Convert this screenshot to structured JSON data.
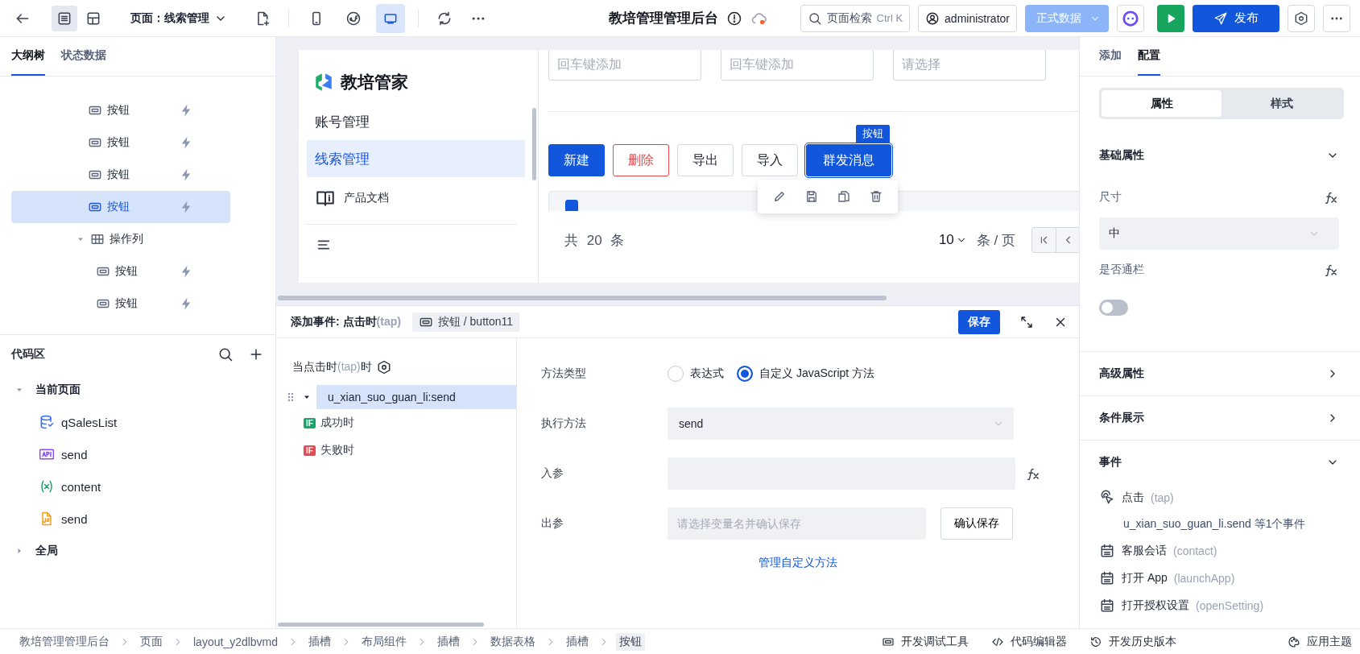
{
  "topbar": {
    "view_toggles": [
      {
        "kind": "document",
        "selected": true
      },
      {
        "kind": "layout",
        "selected": false
      }
    ],
    "page_selector": "页面：线索管理",
    "devices": [
      {
        "kind": "phone",
        "selected": false
      },
      {
        "kind": "miniapp",
        "selected": false
      },
      {
        "kind": "desktop",
        "selected": true
      }
    ],
    "app_title": "教培管理管理后台",
    "search": {
      "placeholder": "页面检索",
      "shortcut": "Ctrl K"
    },
    "user": "administrator",
    "data_mode": "正式数据",
    "publish": "发布"
  },
  "left_panel": {
    "tabs": [
      {
        "label": "大纲树",
        "selected": true
      },
      {
        "label": "状态数据",
        "selected": false
      }
    ],
    "outline": [
      {
        "kind": "button",
        "label": "按钮",
        "selected": false
      },
      {
        "kind": "button",
        "label": "按钮",
        "selected": false
      },
      {
        "kind": "button",
        "label": "按钮",
        "selected": false
      },
      {
        "kind": "button",
        "label": "按钮",
        "selected": true
      },
      {
        "kind": "table",
        "label": "操作列",
        "selected": false,
        "expanded": true,
        "children": [
          {
            "kind": "button",
            "label": "按钮",
            "selected": false
          },
          {
            "kind": "button",
            "label": "按钮",
            "selected": false
          }
        ]
      }
    ],
    "code_area": {
      "title": "代码区",
      "groups": [
        {
          "label": "当前页面",
          "expanded": true,
          "items": [
            {
              "kind": "database",
              "label": "qSalesList"
            },
            {
              "kind": "api",
              "label": "send"
            },
            {
              "kind": "variable",
              "label": "content"
            },
            {
              "kind": "script",
              "label": "send"
            }
          ]
        },
        {
          "label": "全局",
          "expanded": false
        }
      ]
    }
  },
  "canvas": {
    "brand": "教培管家",
    "nav": [
      {
        "label": "账号管理",
        "selected": false
      },
      {
        "label": "线索管理",
        "selected": true
      }
    ],
    "doc_link": "产品文档",
    "filters": [
      {
        "placeholder": "回车键添加"
      },
      {
        "placeholder": "回车键添加"
      },
      {
        "placeholder": "请选择"
      }
    ],
    "actions": [
      {
        "label": "新建",
        "kind": "primary",
        "selected": false
      },
      {
        "label": "删除",
        "kind": "danger",
        "selected": false
      },
      {
        "label": "导出",
        "kind": "default",
        "selected": false
      },
      {
        "label": "导入",
        "kind": "default",
        "selected": false
      },
      {
        "label": "群发消息",
        "kind": "primary",
        "selected": true
      }
    ],
    "selection_badge": "按钮",
    "table_header": {
      "checked": true
    },
    "pagination": {
      "total": "共 20 条",
      "page_size": "10",
      "unit": "条 / 页"
    }
  },
  "event_editor": {
    "title": "添加事件: 点击时",
    "title_hint": "(tap)",
    "component": "按钮 / button11",
    "save": "保存",
    "trigger": {
      "before": "当点击时",
      "hint": "(tap)",
      "after": "时"
    },
    "actions": [
      {
        "label": "u_xian_suo_guan_li:send",
        "selected": true,
        "expanded": true,
        "branches": [
          {
            "badge": "IF",
            "label": "成功时",
            "color": "#1ba56c"
          },
          {
            "badge": "IF",
            "label": "失败时",
            "color": "#e5484d"
          }
        ]
      }
    ],
    "form": {
      "method_type": {
        "label": "方法类型",
        "options": [
          {
            "label": "表达式",
            "selected": false
          },
          {
            "label": "自定义 JavaScript 方法",
            "selected": true
          }
        ]
      },
      "method": {
        "label": "执行方法",
        "value": "send"
      },
      "input": {
        "label": "入参"
      },
      "output": {
        "label": "出参",
        "placeholder": "请选择变量名并确认保存",
        "button": "确认保存"
      },
      "manage_link": "管理自定义方法"
    }
  },
  "right_panel": {
    "tabs": [
      {
        "label": "添加",
        "selected": false
      },
      {
        "label": "配置",
        "selected": true
      }
    ],
    "segments": [
      {
        "label": "属性",
        "selected": true
      },
      {
        "label": "样式",
        "selected": false
      }
    ],
    "sections": [
      {
        "title": "基础属性",
        "expanded": true,
        "fields": [
          {
            "kind": "select",
            "label": "尺寸",
            "value": "中"
          },
          {
            "kind": "switch",
            "label": "是否通栏",
            "on": false
          }
        ]
      },
      {
        "title": "高级属性",
        "expanded": false
      },
      {
        "title": "条件展示",
        "expanded": false
      },
      {
        "title": "事件",
        "expanded": true,
        "events": [
          {
            "kind": "pointer",
            "label": "点击",
            "code": "(tap)",
            "summary": "u_xian_suo_guan_li.send 等1个事件"
          },
          {
            "kind": "calendar",
            "label": "客服会话",
            "code": "(contact)"
          },
          {
            "kind": "calendar",
            "label": "打开 App",
            "code": "(launchApp)"
          },
          {
            "kind": "calendar",
            "label": "打开授权设置",
            "code": "(openSetting)"
          }
        ]
      }
    ]
  },
  "status_bar": {
    "breadcrumb": [
      {
        "label": "教培管理管理后台",
        "selected": false
      },
      {
        "label": "页面",
        "selected": false
      },
      {
        "label": "layout_y2dlbvmd",
        "selected": false
      },
      {
        "label": "插槽",
        "selected": false
      },
      {
        "label": "布局组件",
        "selected": false
      },
      {
        "label": "插槽",
        "selected": false
      },
      {
        "label": "数据表格",
        "selected": false
      },
      {
        "label": "插槽",
        "selected": false
      },
      {
        "label": "按钮",
        "selected": true
      }
    ],
    "tools": [
      {
        "kind": "debug",
        "label": "开发调试工具"
      },
      {
        "kind": "code",
        "label": "代码编辑器"
      },
      {
        "kind": "history",
        "label": "开发历史版本"
      },
      {
        "kind": "theme",
        "label": "应用主题"
      }
    ]
  }
}
